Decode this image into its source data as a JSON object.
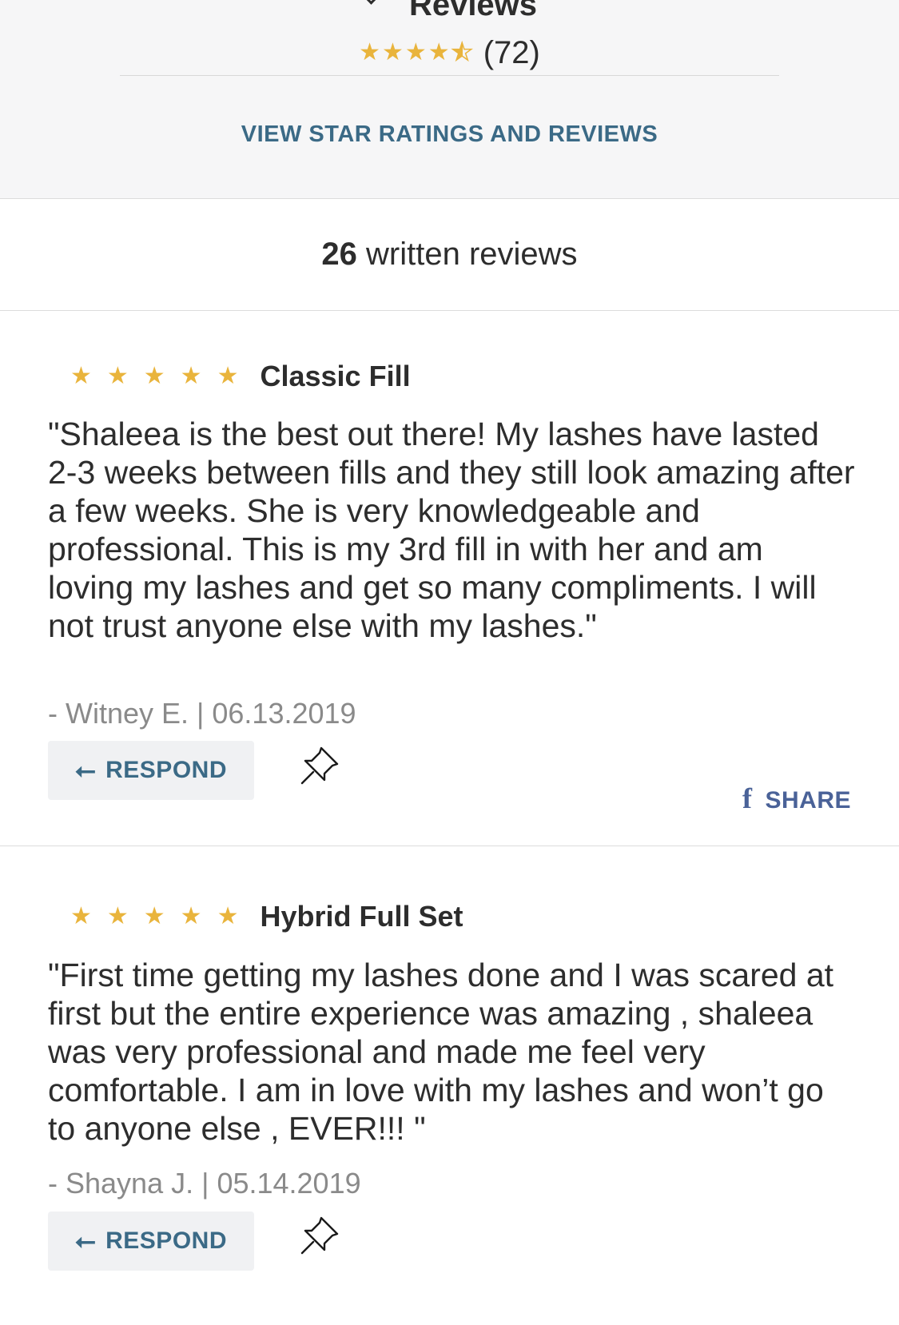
{
  "header": {
    "title": "Reviews",
    "rating_count": "(72)",
    "stars_full": "★★★★",
    "star_half": "★",
    "view_link": "VIEW STAR RATINGS AND REVIEWS"
  },
  "written_reviews": {
    "count": "26",
    "label": "written reviews"
  },
  "reviews": [
    {
      "stars": "★★★★★",
      "rating": 5,
      "service": "Classic Fill",
      "text": "\"Shaleea is the best out there! My lashes have lasted 2-3 weeks between fills and they still look amazing after a few weeks. She is very knowledgeable and professional. This is my 3rd fill in with her and am loving my lashes and get so many compliments. I will not trust anyone else with my lashes.\"",
      "meta": "- Witney E. | 06.13.2019",
      "respond_label": "RESPOND",
      "share_label": "SHARE"
    },
    {
      "stars": "★★★★★",
      "rating": 5,
      "service": "Hybrid Full Set",
      "text": "\"First time getting my lashes done and I was scared at first but the entire experience was amazing , shaleea was very professional and made me feel very comfortable. I am in love with my lashes and won’t go to anyone else , EVER!!! \"",
      "meta": "- Shayna J. | 05.14.2019",
      "respond_label": "RESPOND"
    }
  ],
  "overall_rating": 4.5,
  "colors": {
    "accent": "#3b6a86",
    "star": "#e9b43c",
    "facebook": "#4a6298"
  },
  "icons": {
    "respond": "reply-arrow-icon",
    "pin": "pushpin-icon",
    "share": "facebook-icon",
    "expand": "chevron-down-icon"
  }
}
